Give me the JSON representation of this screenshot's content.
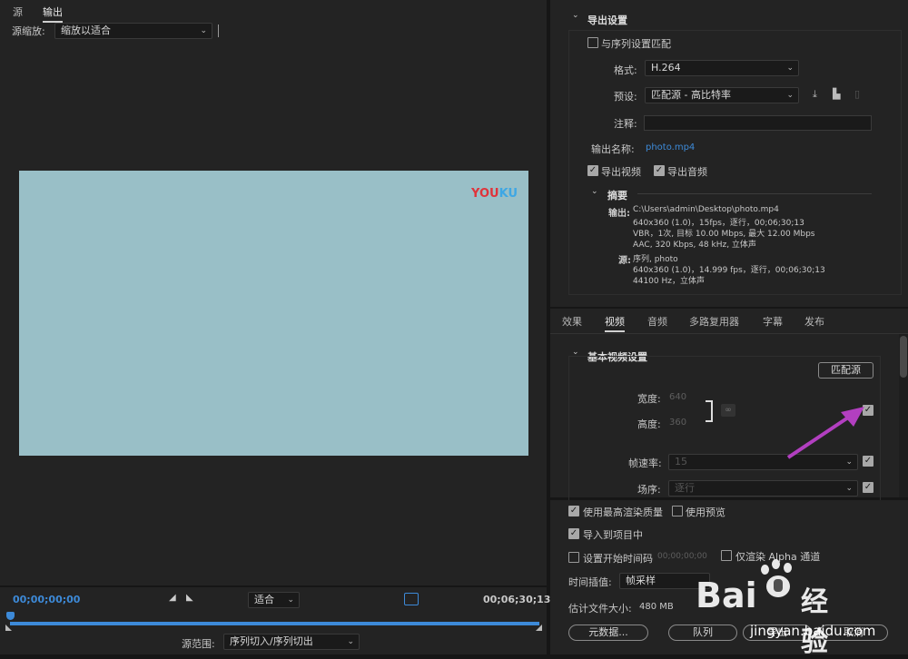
{
  "left": {
    "tabs": [
      {
        "label": "源"
      },
      {
        "label": "输出"
      }
    ],
    "scale_label": "源缩放:",
    "scale_value": "缩放以适合",
    "video_watermark": "YOUKU",
    "time_start": "00;00;00;00",
    "time_end": "00;06;30;13",
    "fit_value": "适合",
    "range_label": "源范围:",
    "range_value": "序列切入/序列切出"
  },
  "export": {
    "section_title": "导出设置",
    "match_seq": "与序列设置匹配",
    "format_label": "格式:",
    "format_value": "H.264",
    "preset_label": "预设:",
    "preset_value": "匹配源 - 高比特率",
    "comment_label": "注释:",
    "output_name_label": "输出名称:",
    "output_name_value": "photo.mp4",
    "export_video": "导出视频",
    "export_audio": "导出音频",
    "summary_title": "摘要",
    "output_label": "输出:",
    "output_lines": [
      "C:\\Users\\admin\\Desktop\\photo.mp4",
      "640x360 (1.0)，15fps，逐行，00;06;30;13",
      "VBR，1次, 目标 10.00 Mbps, 最大 12.00 Mbps",
      "AAC, 320 Kbps, 48  kHz, 立体声"
    ],
    "source_label": "源:",
    "source_lines": [
      "序列, photo",
      "640x360 (1.0)，14.999 fps，逐行，00;06;30;13",
      "44100 Hz，立体声"
    ]
  },
  "tabs2": [
    {
      "label": "效果"
    },
    {
      "label": "视频"
    },
    {
      "label": "音频"
    },
    {
      "label": "多路复用器"
    },
    {
      "label": "字幕"
    },
    {
      "label": "发布"
    }
  ],
  "video": {
    "section_title": "基本视频设置",
    "match_source_btn": "匹配源",
    "width_label": "宽度:",
    "width_value": "640",
    "height_label": "高度:",
    "height_value": "360",
    "framerate_label": "帧速率:",
    "framerate_value": "15",
    "field_label": "场序:",
    "field_value": "逐行"
  },
  "bottom": {
    "max_render": "使用最高渲染质量",
    "use_preview": "使用预览",
    "import_project": "导入到项目中",
    "set_start_tc": "设置开始时间码",
    "start_tc_value": "00;00;00;00",
    "alpha_only": "仅渲染 Alpha 通道",
    "interp_label": "时间插值:",
    "interp_value": "帧采样",
    "est_size": "估计文件大小:",
    "est_size_value": "480 MB",
    "metadata_btn": "元数据...",
    "queue_btn": "队列",
    "export_btn": "导出",
    "cancel_btn": "取消"
  },
  "watermark": {
    "brand": "Bai",
    "brand_cn": "经验",
    "url": "jingyan.baidu.com"
  },
  "colors": {
    "accent_blue": "#3d8ad8",
    "arrow": "#b23fc0",
    "video_bg": "#99bfc7"
  }
}
